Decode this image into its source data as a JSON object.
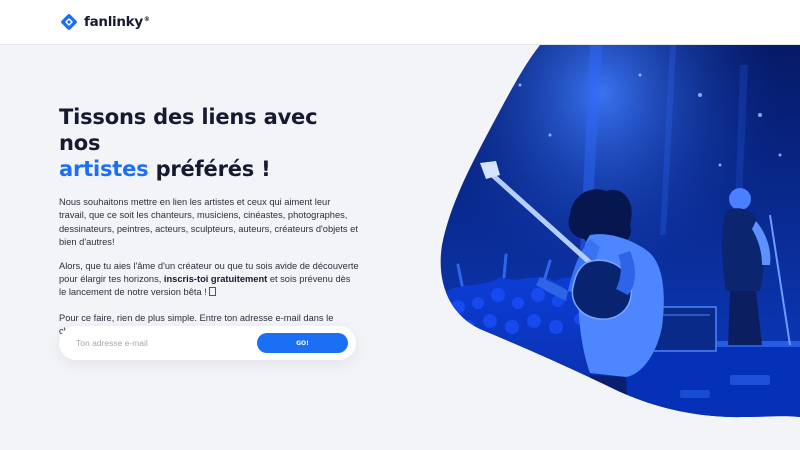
{
  "header": {
    "logo_text": "fanlinky",
    "logo_reg": "®"
  },
  "hero": {
    "title_part1": "Tissons des liens avec nos",
    "title_accent": "artistes",
    "title_part2": " préférés !",
    "paragraph1": "Nous souhaitons mettre en lien les artistes et ceux qui aiment leur travail, que ce soit les chanteurs, musiciens, cinéastes, photographes, dessinateurs, peintres, acteurs, sculpteurs, auteurs, créateurs d'objets et bien d'autres!",
    "paragraph2_before": "Alors, que tu aies l'âme d'un créateur ou que tu sois avide de découverte pour élargir tes horizons, ",
    "paragraph2_bold": "inscris-toi gratuitement",
    "paragraph2_after": " et sois prévenu dès le lancement de notre version bêta !",
    "paragraph3": "Pour ce faire, rien de plus simple. Entre ton adresse e-mail dans le champ ci-dessous, et nous nous occupons du reste !"
  },
  "signup": {
    "email_placeholder": "Ton adresse e-mail",
    "email_value": "",
    "submit_label": "GO!"
  },
  "colors": {
    "accent": "#1a6ff5",
    "title": "#151a30",
    "background": "#f3f4f7",
    "photo_tint": "#0a3fd6"
  }
}
